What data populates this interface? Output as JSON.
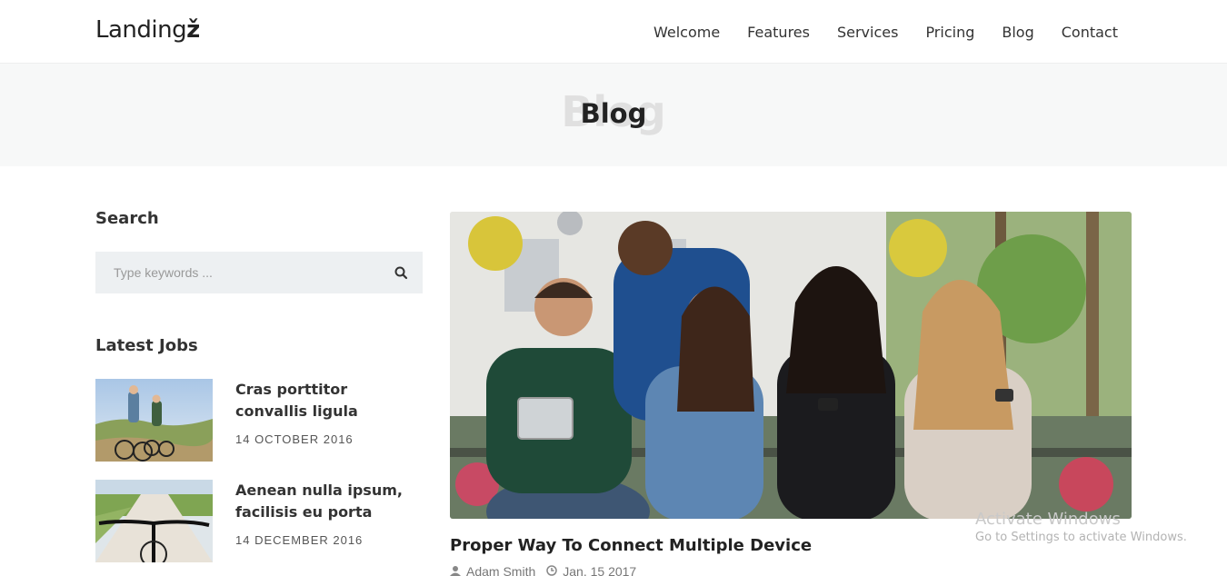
{
  "header": {
    "logo_text": "Landing",
    "logo_accent": "ž",
    "nav": [
      {
        "label": "Welcome"
      },
      {
        "label": "Features"
      },
      {
        "label": "Services"
      },
      {
        "label": "Pricing"
      },
      {
        "label": "Blog"
      },
      {
        "label": "Contact"
      }
    ]
  },
  "page": {
    "title": "Blog",
    "title_ghost": "Blog"
  },
  "sidebar": {
    "search": {
      "title": "Search",
      "placeholder": "Type keywords ...",
      "icon": "search-icon"
    },
    "latest_jobs": {
      "title": "Latest Jobs",
      "items": [
        {
          "title": "Cras porttitor convallis ligula",
          "date": "14 OCTOBER 2016"
        },
        {
          "title": "Aenean nulla ipsum, facilisis eu porta",
          "date": "14 DECEMBER 2016"
        }
      ]
    }
  },
  "post": {
    "title": "Proper Way To Connect Multiple Device",
    "author": "Adam Smith",
    "date": "Jan. 15 2017",
    "author_icon": "user-icon",
    "date_icon": "clock-icon"
  },
  "watermark": {
    "line1": "Activate Windows",
    "line2": "Go to Settings to activate Windows."
  }
}
